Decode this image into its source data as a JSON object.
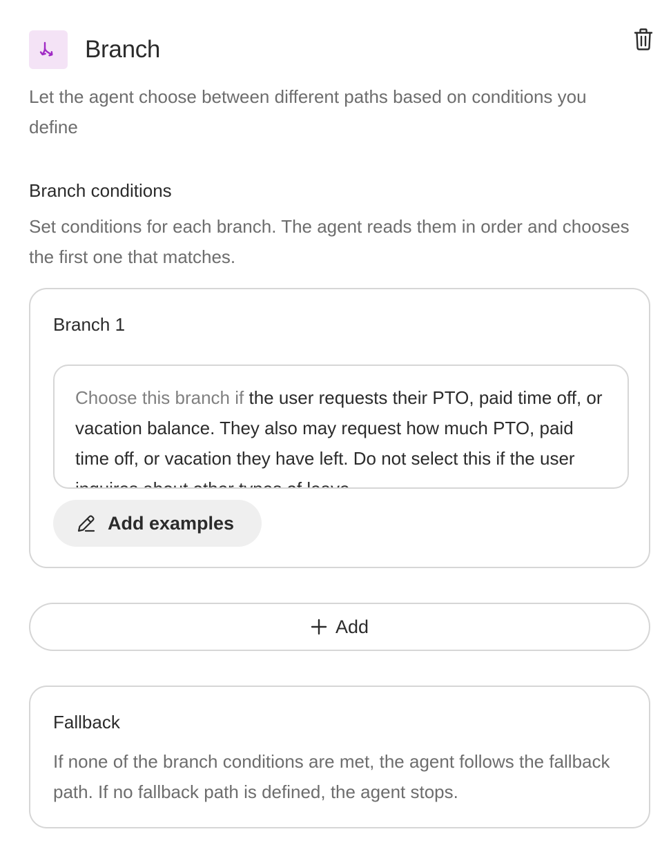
{
  "header": {
    "title": "Branch",
    "icon": "branch-split-icon",
    "icon_color": "#a02ac4",
    "icon_bg": "#f4e3f6",
    "delete_icon": "trash-icon"
  },
  "description": "Let the agent choose between different paths based on conditions you define",
  "conditions_section": {
    "title": "Branch conditions",
    "description": "Set conditions for each branch. The agent reads them in order and chooses the first one that matches."
  },
  "branches": [
    {
      "title": "Branch 1",
      "condition_prefix": "Choose this branch if",
      "condition_text": "the user requests their PTO, paid time off, or vacation balance.  They also may request how much PTO, paid time off, or vacation they have left.  Do not select this if the user inquires about other types of leave.",
      "add_examples_label": "Add examples",
      "add_examples_icon": "pencil-icon"
    }
  ],
  "add_button": {
    "label": "Add",
    "icon": "plus-icon"
  },
  "fallback": {
    "title": "Fallback",
    "description": "If none of the branch conditions are met, the agent follows the fallback path. If no fallback path is defined, the agent stops."
  }
}
